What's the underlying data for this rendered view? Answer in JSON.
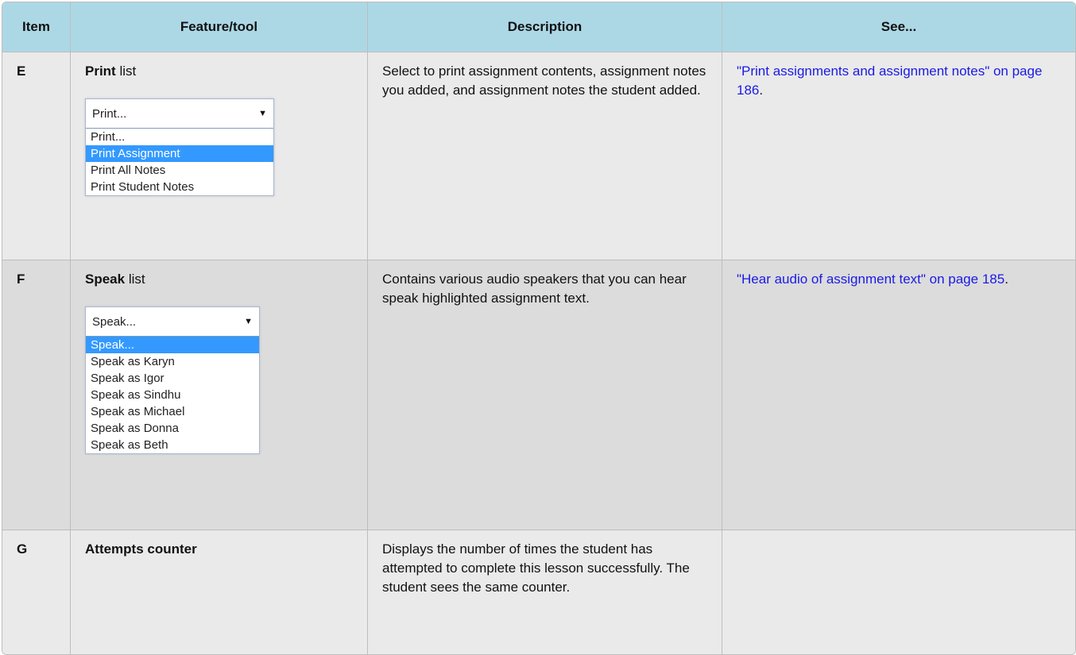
{
  "headers": [
    "Item",
    "Feature/tool",
    "Description",
    "See..."
  ],
  "rows": [
    {
      "item": "E",
      "feature_bold": "Print",
      "feature_rest": " list",
      "dropdown": {
        "selected": "Print...",
        "options": [
          "Print...",
          "Print Assignment",
          "Print All Notes",
          "Print Student Notes"
        ],
        "highlighted": "Print Assignment"
      },
      "description": "Select to print assignment contents, assignment notes you added, and assignment notes the student added.",
      "see_link": "\"Print assignments and assignment notes\" on page 186",
      "see_after": "."
    },
    {
      "item": "F",
      "feature_bold": "Speak",
      "feature_rest": " list",
      "dropdown": {
        "selected": "Speak...",
        "options": [
          "Speak...",
          "Speak as Karyn",
          "Speak as Igor",
          "Speak as Sindhu",
          "Speak as Michael",
          "Speak as Donna",
          "Speak as Beth"
        ],
        "highlighted": "Speak..."
      },
      "description": "Contains various audio speakers that you can hear speak highlighted assignment text.",
      "see_link": "\"Hear audio of assignment text\" on page 185",
      "see_after": "."
    },
    {
      "item": "G",
      "feature_bold": "Attempts counter",
      "feature_rest": "",
      "description": "Displays the number of times the student has attempted to complete this lesson successfully. The student sees the same counter.",
      "see_link": "",
      "see_after": ""
    }
  ],
  "colors": {
    "header_bg": "#acd8e6",
    "row_light": "#eaeaea",
    "row_dark": "#dcdcdc",
    "link": "#1a1ae6",
    "highlight": "#3399ff"
  },
  "icons": {
    "dropdown_arrow": "triangle-down-icon"
  }
}
